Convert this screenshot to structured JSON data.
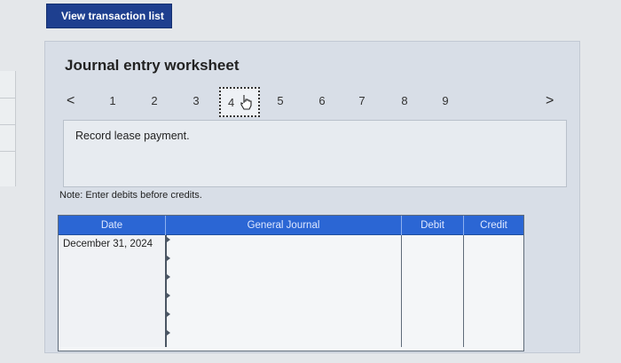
{
  "toolbar": {
    "view_transactions_label": "View transaction list"
  },
  "worksheet": {
    "title": "Journal entry worksheet",
    "nav": {
      "prev_glyph": "<",
      "next_glyph": ">",
      "items": [
        "1",
        "2",
        "3",
        "4",
        "5",
        "6",
        "7",
        "8",
        "9"
      ],
      "active": "4"
    },
    "description": "Record lease payment.",
    "note": "Note: Enter debits before credits."
  },
  "table": {
    "headers": {
      "date": "Date",
      "journal": "General Journal",
      "debit": "Debit",
      "credit": "Credit"
    },
    "rows": [
      {
        "date": "December 31, 2024"
      },
      {
        "date": ""
      },
      {
        "date": ""
      },
      {
        "date": ""
      },
      {
        "date": ""
      },
      {
        "date": ""
      }
    ]
  },
  "colors": {
    "button": "#1e3f8f",
    "header": "#2b66d4",
    "panel": "#d8dee7"
  },
  "icons": {
    "cursor": "hand-pointer-icon"
  }
}
